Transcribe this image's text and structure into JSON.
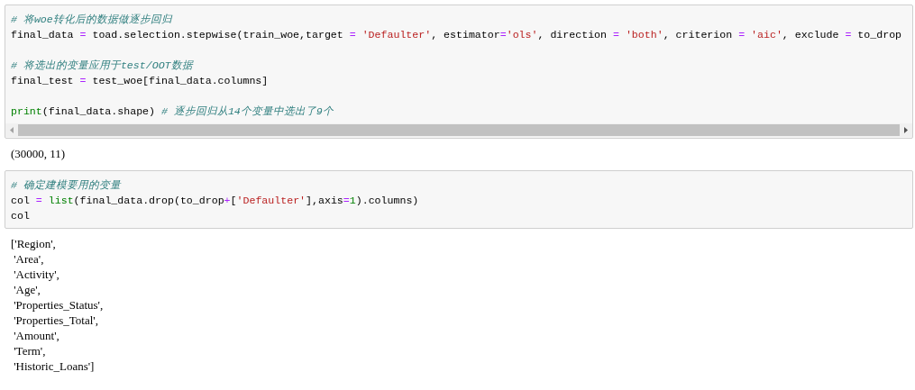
{
  "cells": [
    {
      "input": [
        {
          "kind": "code",
          "tokens": [
            {
              "kind": "comment",
              "text": "# 将woe转化后的数据做逐步回归"
            }
          ]
        },
        {
          "kind": "code",
          "tokens": [
            {
              "kind": "plain",
              "text": "final_data "
            },
            {
              "kind": "operator",
              "text": "="
            },
            {
              "kind": "plain",
              "text": " toad.selection.stepwise(train_woe,target "
            },
            {
              "kind": "operator",
              "text": "= "
            },
            {
              "kind": "string",
              "text": "'Defaulter'"
            },
            {
              "kind": "plain",
              "text": ", estimator"
            },
            {
              "kind": "operator",
              "text": "="
            },
            {
              "kind": "string",
              "text": "'ols'"
            },
            {
              "kind": "plain",
              "text": ", direction "
            },
            {
              "kind": "operator",
              "text": "= "
            },
            {
              "kind": "string",
              "text": "'both'"
            },
            {
              "kind": "plain",
              "text": ", criterion "
            },
            {
              "kind": "operator",
              "text": "= "
            },
            {
              "kind": "string",
              "text": "'aic'"
            },
            {
              "kind": "plain",
              "text": ", exclude "
            },
            {
              "kind": "operator",
              "text": "="
            },
            {
              "kind": "plain",
              "text": " to_drop"
            }
          ]
        },
        {
          "kind": "blank"
        },
        {
          "kind": "code",
          "tokens": [
            {
              "kind": "comment",
              "text": "# 将选出的变量应用于test/OOT数据"
            }
          ]
        },
        {
          "kind": "code",
          "tokens": [
            {
              "kind": "plain",
              "text": "final_test "
            },
            {
              "kind": "operator",
              "text": "="
            },
            {
              "kind": "plain",
              "text": " test_woe[final_data.columns]"
            }
          ]
        },
        {
          "kind": "blank"
        },
        {
          "kind": "code",
          "tokens": [
            {
              "kind": "builtin",
              "text": "print"
            },
            {
              "kind": "plain",
              "text": "(final_data.shape) "
            },
            {
              "kind": "comment",
              "text": "# 逐步回归从14个变量中选出了9个"
            }
          ]
        }
      ],
      "scrollbar": true,
      "output": [
        "(30000, 11)"
      ]
    },
    {
      "input": [
        {
          "kind": "code",
          "tokens": [
            {
              "kind": "comment",
              "text": "# 确定建模要用的变量"
            }
          ]
        },
        {
          "kind": "code",
          "tokens": [
            {
              "kind": "plain",
              "text": "col "
            },
            {
              "kind": "operator",
              "text": "= "
            },
            {
              "kind": "builtin",
              "text": "list"
            },
            {
              "kind": "plain",
              "text": "(final_data.drop(to_drop"
            },
            {
              "kind": "operator",
              "text": "+"
            },
            {
              "kind": "plain",
              "text": "["
            },
            {
              "kind": "string",
              "text": "'Defaulter'"
            },
            {
              "kind": "plain",
              "text": "],axis"
            },
            {
              "kind": "operator",
              "text": "="
            },
            {
              "kind": "number",
              "text": "1"
            },
            {
              "kind": "plain",
              "text": ").columns)"
            }
          ]
        },
        {
          "kind": "code",
          "tokens": [
            {
              "kind": "plain",
              "text": "col"
            }
          ]
        }
      ],
      "scrollbar": false,
      "output": [
        "['Region',",
        " 'Area',",
        " 'Activity',",
        " 'Age',",
        " 'Properties_Status',",
        " 'Properties_Total',",
        " 'Amount',",
        " 'Term',",
        " 'Historic_Loans']"
      ]
    }
  ]
}
